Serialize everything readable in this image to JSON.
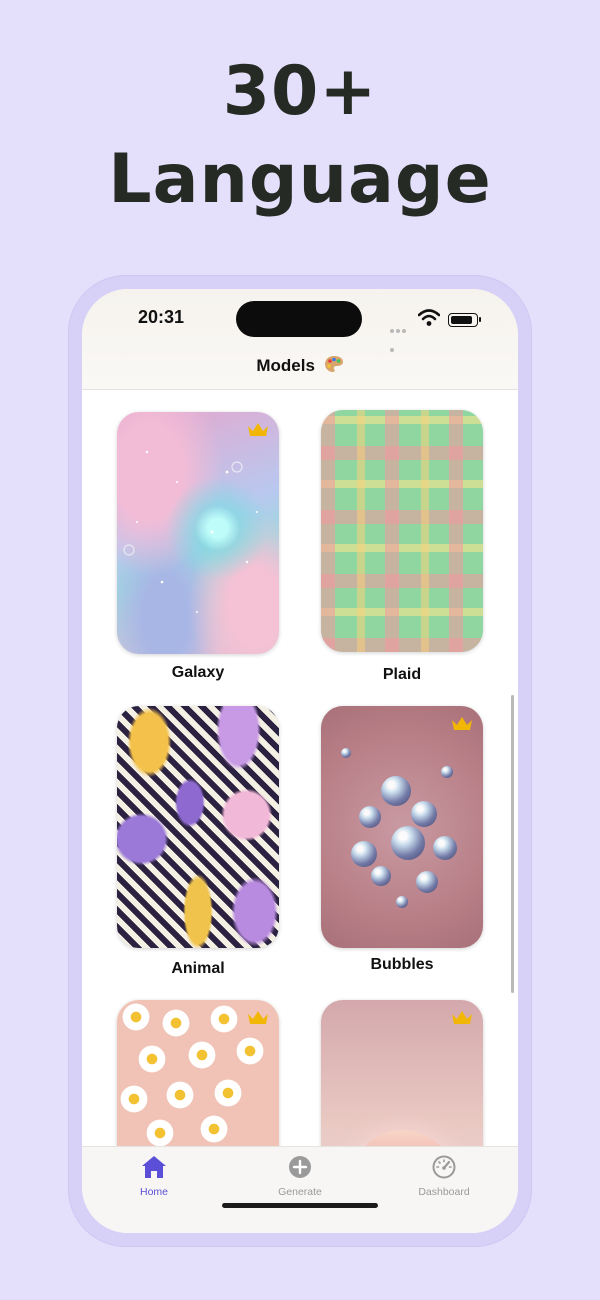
{
  "headline": {
    "line1": "30+",
    "line2": "Language"
  },
  "status_bar": {
    "time": "20:31"
  },
  "nav": {
    "title": "Models",
    "title_icon": "palette-icon"
  },
  "models": [
    {
      "name": "Galaxy",
      "premium": true
    },
    {
      "name": "Plaid",
      "premium": false
    },
    {
      "name": "Animal",
      "premium": false
    },
    {
      "name": "Bubbles",
      "premium": true
    },
    {
      "name": "",
      "premium": true
    },
    {
      "name": "",
      "premium": true
    }
  ],
  "tabs": [
    {
      "label": "Home",
      "icon": "home-icon",
      "active": true
    },
    {
      "label": "Generate",
      "icon": "plus-circle-icon",
      "active": false
    },
    {
      "label": "Dashboard",
      "icon": "speedometer-icon",
      "active": false
    }
  ],
  "colors": {
    "accent": "#5a4fd6",
    "inactive": "#9a9a9a",
    "background": "#e4dffa",
    "crown": "#f2b705"
  }
}
